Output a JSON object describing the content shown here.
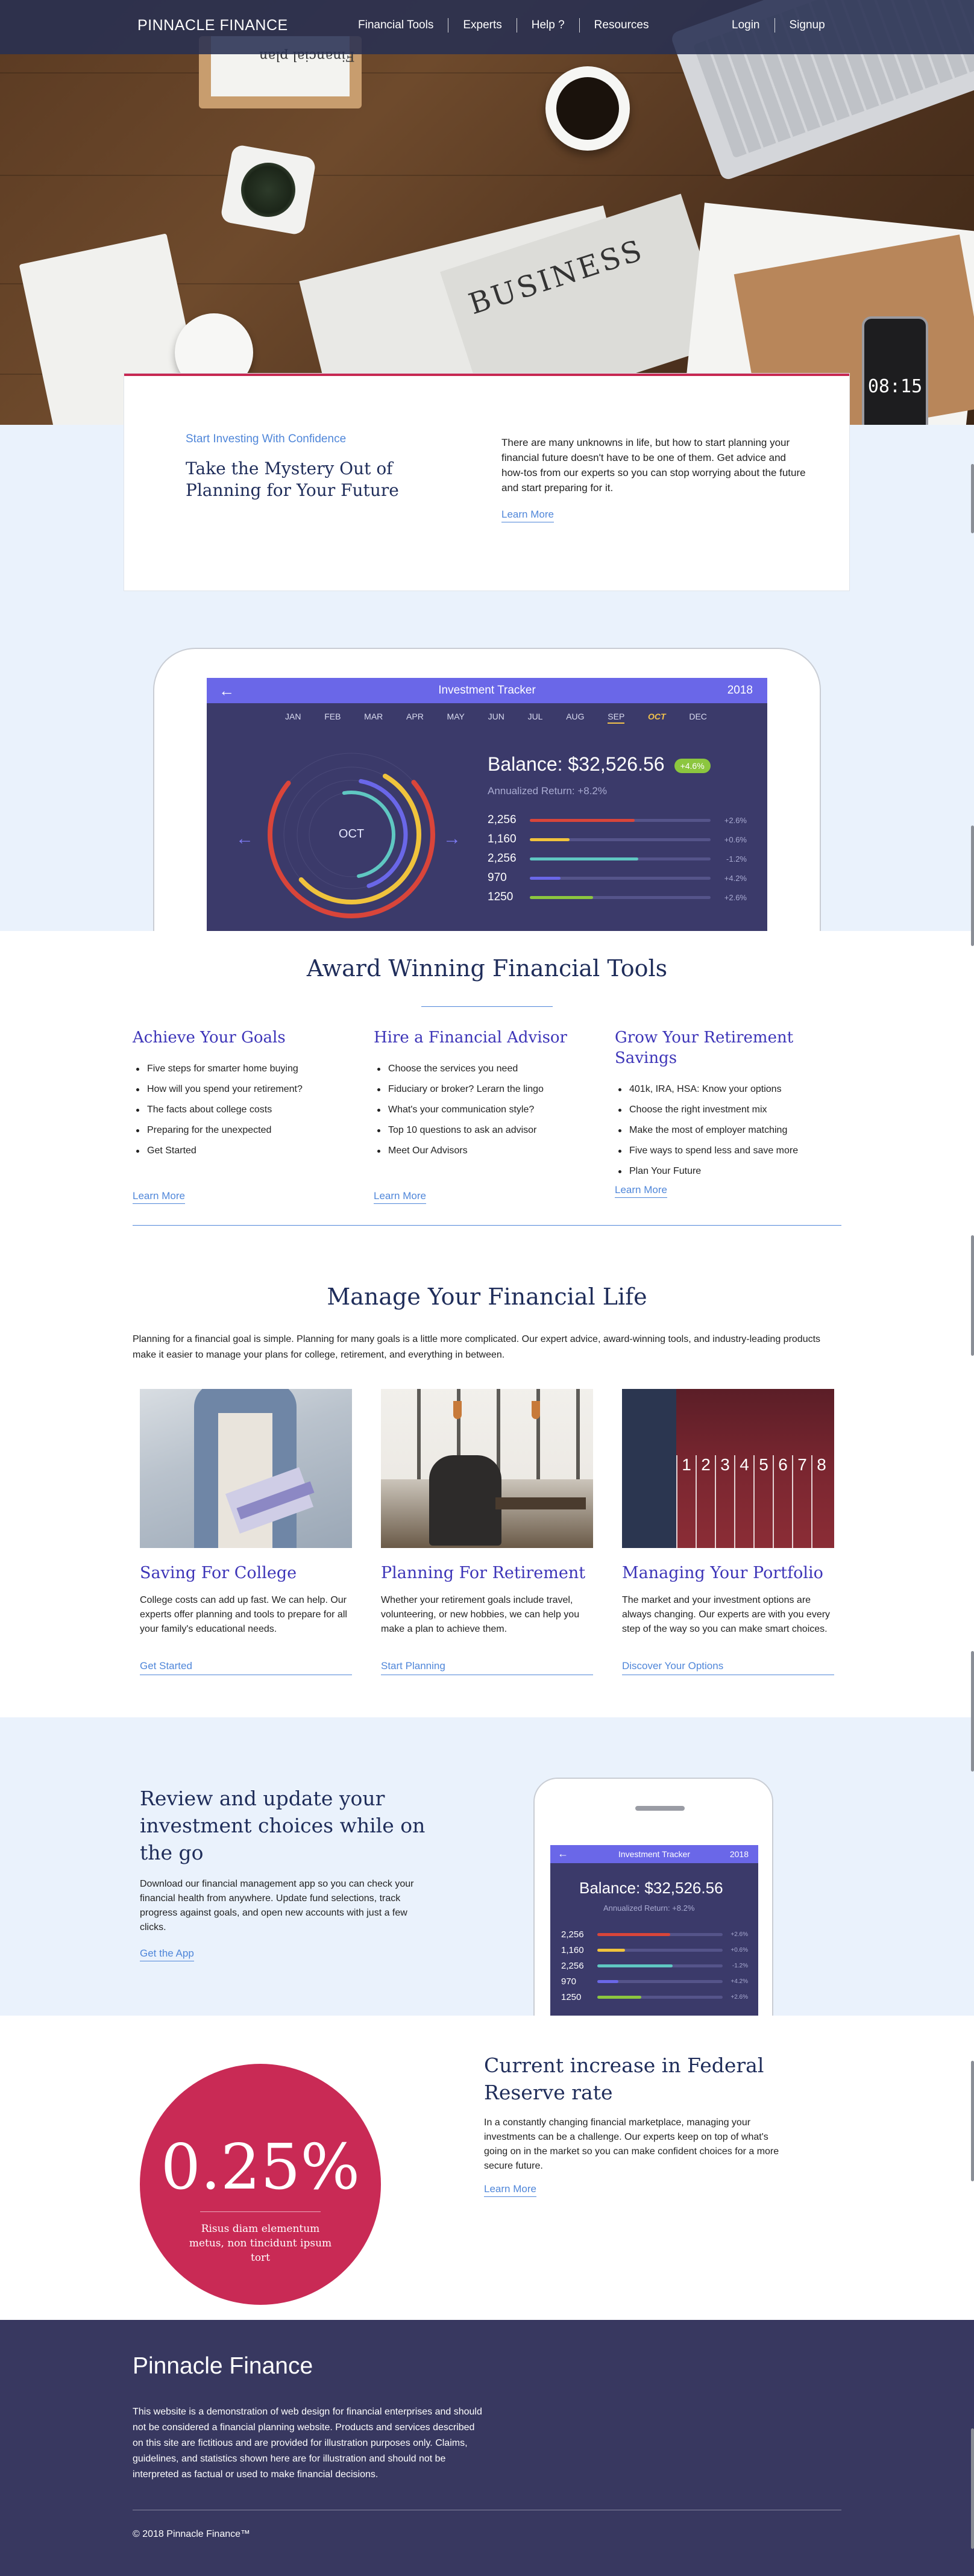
{
  "nav": {
    "brand": "PINNACLE FINANCE",
    "links": [
      "Financial Tools",
      "Experts",
      "Help ?",
      "Resources"
    ],
    "auth": [
      "Login",
      "Signup"
    ]
  },
  "hero": {
    "clipboard_text": "Financial plan",
    "newspaper_text": "BUSINESS",
    "phone_time": "08:15"
  },
  "intro": {
    "eyebrow": "Start Investing With Confidence",
    "title": "Take the Mystery Out of Planning for Your Future",
    "body": "There are many unknowns in life, but how to start planning your financial future doesn't have to be one of them. Get advice and how-tos from our experts so you can stop worrying about the future and start preparing for it.",
    "link": "Learn More"
  },
  "tracker": {
    "title": "Investment Tracker",
    "year": "2018",
    "back_icon": "arrow-left-icon",
    "months": [
      "JAN",
      "FEB",
      "MAR",
      "APR",
      "MAY",
      "JUN",
      "JUL",
      "AUG",
      "SEP",
      "OCT",
      "DEC"
    ],
    "selected_month": "OCT",
    "balance": "Balance: $32,526.56",
    "badge": "+4.6%",
    "annualized": "Annualized Return: +8.2%",
    "rows": [
      {
        "value": "2,256",
        "pct": "+2.6%",
        "fill": 0.58,
        "color": "#d9453a"
      },
      {
        "value": "1,160",
        "pct": "+0.6%",
        "fill": 0.22,
        "color": "#f0c33c"
      },
      {
        "value": "2,256",
        "pct": "-1.2%",
        "fill": 0.6,
        "color": "#5fc7c2"
      },
      {
        "value": "970",
        "pct": "+4.2%",
        "fill": 0.17,
        "color": "#6a67e8"
      },
      {
        "value": "1250",
        "pct": "+2.6%",
        "fill": 0.35,
        "color": "#8cc63f"
      }
    ],
    "rings": [
      {
        "color": "#d9453a",
        "fraction": 0.72
      },
      {
        "color": "#f0c33c",
        "fraction": 0.55
      },
      {
        "color": "#6a67e8",
        "fraction": 0.42
      },
      {
        "color": "#5fc7c2",
        "fraction": 0.5
      }
    ]
  },
  "award": {
    "title": "Award Winning Financial Tools",
    "columns": [
      {
        "heading": "Achieve Your Goals",
        "items": [
          "Five steps for smarter home buying",
          "How will you spend your retirement?",
          "The facts about college costs",
          "Preparing for the unexpected",
          "Get Started"
        ],
        "link": "Learn More"
      },
      {
        "heading": "Hire a Financial Advisor",
        "items": [
          "Choose the services you need",
          "Fiduciary or broker? Lerarn the lingo",
          "What's your communication style?",
          "Top 10 questions to ask an advisor",
          "Meet Our Advisors"
        ],
        "link": "Learn More"
      },
      {
        "heading": "Grow Your Retirement Savings",
        "items": [
          "401k, IRA, HSA: Know your options",
          "Choose the right investment mix",
          "Make the most of employer matching",
          "Five ways to spend less and save more",
          "Plan Your Future"
        ],
        "link": "Learn More"
      }
    ]
  },
  "manage": {
    "title": "Manage Your Financial Life",
    "intro": "Planning for a financial goal is simple. Planning for many goals is a little more complicated. Our expert advice, award-winning tools, and industry-leading products make it easier to manage your plans for college, retirement, and everything in between.",
    "cards": [
      {
        "heading": "Saving For College",
        "body": "College costs can add up fast. We can help. Our experts offer planning and tools to prepare for all your family's educational needs.",
        "link": "Get Started"
      },
      {
        "heading": "Planning For Retirement",
        "body": "Whether your retirement goals include travel, volunteering, or new hobbies, we can help you make a plan to achieve them.",
        "link": "Start Planning"
      },
      {
        "heading": "Managing Your Portfolio",
        "body": "The market and your investment options are always changing. Our experts are with you every step of the way so you can make smart choices.",
        "link": "Discover Your Options"
      }
    ],
    "track_numbers": [
      "1",
      "2",
      "3",
      "4",
      "5",
      "6",
      "7",
      "8"
    ]
  },
  "app": {
    "title": "Review and update your investment choices while on the go",
    "body": "Download our financial management app so you can check your financial health from anywhere. Update fund selections, track progress against goals, and open new accounts with just a few clicks.",
    "link": "Get the App"
  },
  "rate": {
    "value": "0.25%",
    "caption": "Risus diam elementum metus, non tincidunt ipsum tort",
    "title": "Current increase in Federal Reserve rate",
    "body": "In a constantly changing financial marketplace, managing your investments can be a challenge. Our experts keep on top of what's going on in the market so you can make confident choices for a more secure future.",
    "link": "Learn More"
  },
  "footer": {
    "brand": "Pinnacle Finance",
    "body": "This website is a demonstration of web design for financial enterprises and should not be considered a financial planning website. Products and services described on this site are fictitious and are provided for illustration purposes only. Claims, guidelines, and statistics shown here are for illustration and should not be interpreted as factual or used to make financial decisions.",
    "copyright": "© 2018 Pinnacle Finance™"
  }
}
